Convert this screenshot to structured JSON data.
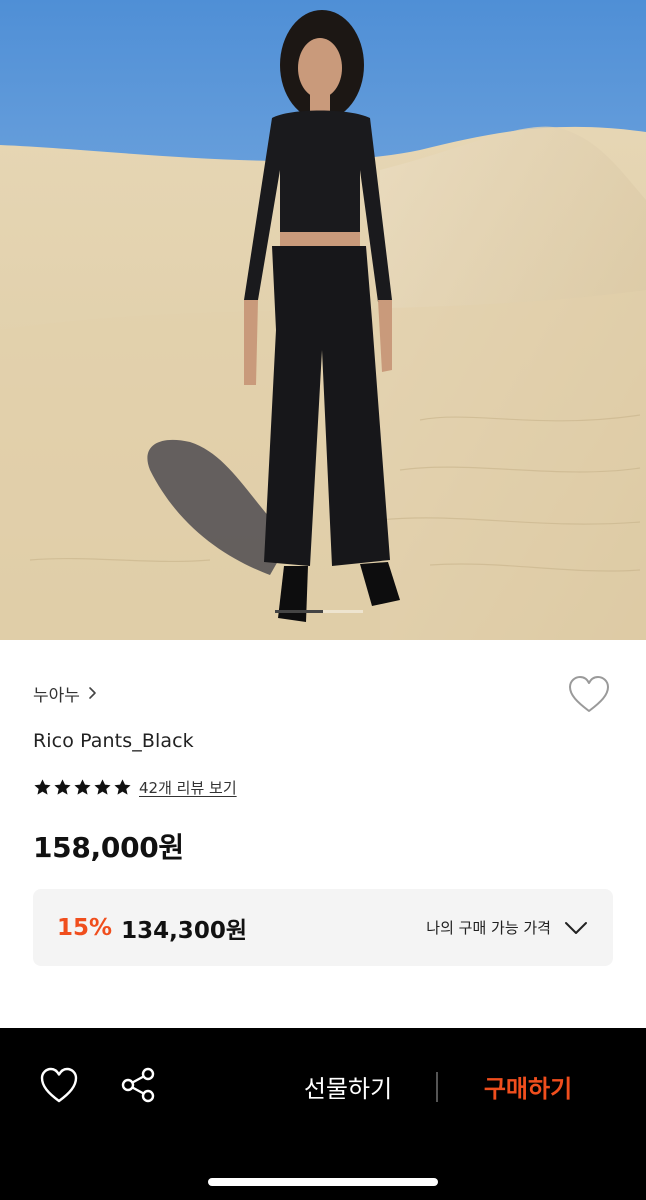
{
  "product": {
    "brand": "누아누",
    "name": "Rico Pants_Black",
    "rating_stars": 5,
    "review_link": "42개 리뷰 보기",
    "price": "158,000원",
    "member_discount": {
      "rate": "15%",
      "price": "134,300원",
      "label": "나의 구매 가능 가격"
    }
  },
  "carousel": {
    "current": 1,
    "total": 2
  },
  "bottom_bar": {
    "gift_label": "선물하기",
    "buy_label": "구매하기"
  },
  "colors": {
    "accent": "#f04e1d",
    "bar_background": "#000000",
    "box_background": "#f4f4f4"
  },
  "icons": [
    "heart-icon",
    "chevron-right-icon",
    "star-icon",
    "chevron-down-icon",
    "share-icon"
  ]
}
